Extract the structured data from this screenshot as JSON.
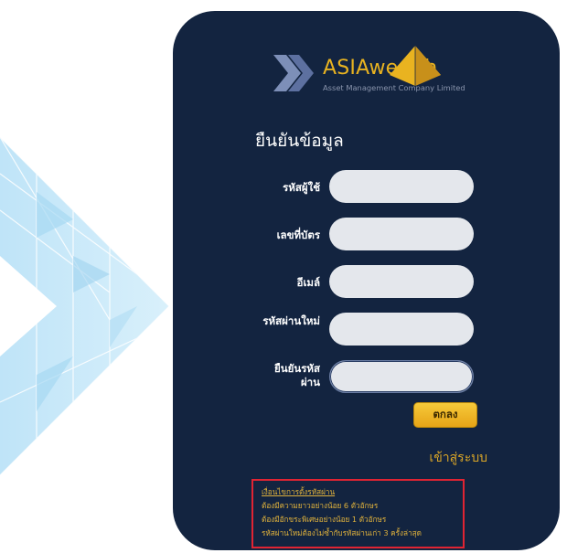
{
  "logo": {
    "name": "ASIAwealth",
    "subtitle": "Asset Management Company Limited"
  },
  "form": {
    "title": "ยืนยันข้อมูล",
    "fields": [
      {
        "label": "รหัสผู้ใช้",
        "value": ""
      },
      {
        "label": "เลขที่บัตร",
        "value": ""
      },
      {
        "label": "อีเมล์",
        "value": ""
      },
      {
        "label": "รหัสผ่านใหม่",
        "value": ""
      },
      {
        "label": "ยืนยันรหัสผ่าน",
        "value": ""
      }
    ],
    "ok_label": "ตกลง",
    "login_link": "เข้าสู่ระบบ"
  },
  "password_rules": {
    "heading": "เงื่อนไขการตั้งรหัสผ่าน",
    "items": [
      "ต้องมีความยาวอย่างน้อย 6 ตัวอักษร",
      "ต้องมีอักขระพิเศษอย่างน้อย 1 ตัวอักษร",
      "รหัสผ่านใหม่ต้องไม่ซ้ำกับรหัสผ่านเก่า 3 ครั้งล่าสุด"
    ]
  },
  "colors": {
    "card_background": "#132440",
    "brand_gold": "#e9b320",
    "highlight_border": "#e02433",
    "input_fill": "#e4e7ec"
  }
}
